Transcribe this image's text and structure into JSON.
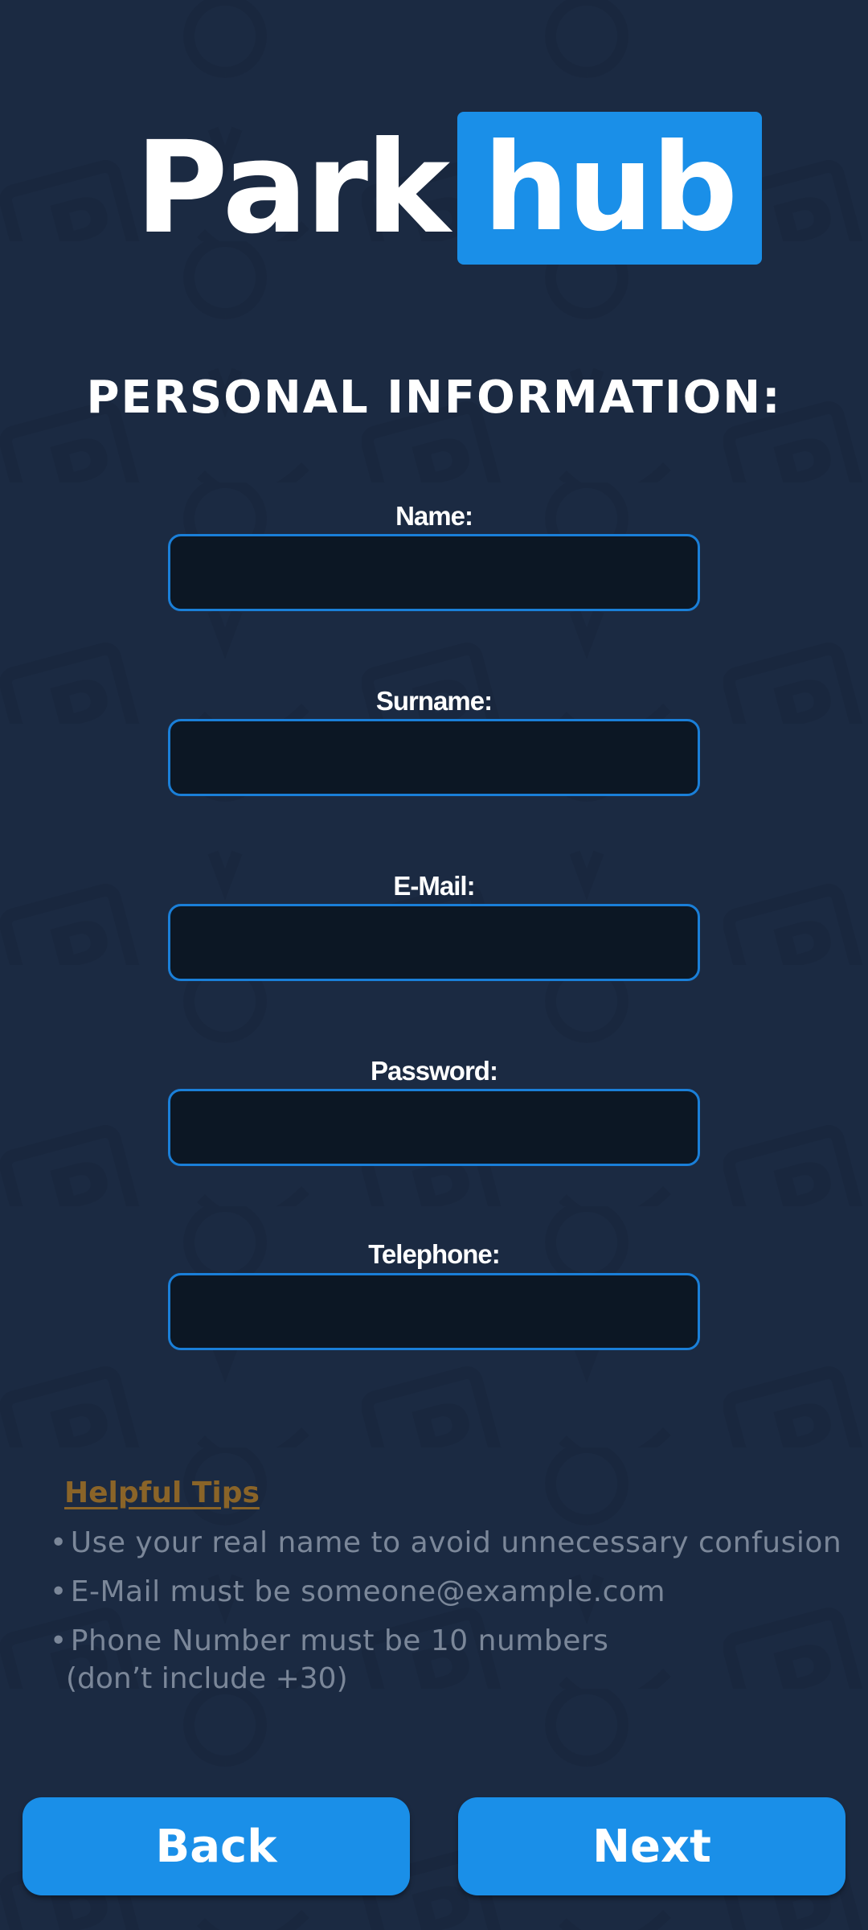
{
  "brand": {
    "logo_left": "Park",
    "logo_right": "hub"
  },
  "page_title": "PERSONAL INFORMATION:",
  "form": {
    "fields": [
      {
        "label": "Name:",
        "value": ""
      },
      {
        "label": "Surname:",
        "value": ""
      },
      {
        "label": "E-Mail:",
        "value": ""
      },
      {
        "label": "Password:",
        "value": ""
      },
      {
        "label": "Telephone:",
        "value": ""
      }
    ]
  },
  "tips": {
    "title": "Helpful Tips",
    "bullet": "•",
    "items": [
      "Use your real name to avoid unnecessary confusion",
      "E-Mail must be someone@example.com",
      "Phone Number must be 10 numbers"
    ],
    "item_continuation": "(don’t include +30)"
  },
  "buttons": {
    "back": "Back",
    "next": "Next"
  },
  "colors": {
    "background": "#1b2a42",
    "accent": "#1a8fe8",
    "input_bg": "#0c1724",
    "input_border": "#1a7fd8",
    "tips_title": "#8a6428",
    "tips_text": "#7b8799"
  }
}
